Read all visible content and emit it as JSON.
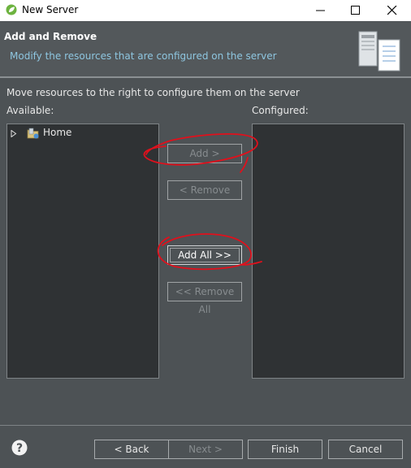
{
  "window": {
    "title": "New Server"
  },
  "header": {
    "title": "Add and Remove",
    "subtitle": "Modify the resources that are configured on the server"
  },
  "main": {
    "description": "Move resources to the right to configure them on the server",
    "available_label": "Available:",
    "configured_label": "Configured:",
    "available_items": [
      {
        "label": "Home",
        "icon": "project-icon",
        "expanded": false
      }
    ],
    "configured_items": []
  },
  "buttons": {
    "add": "Add >",
    "remove": "< Remove",
    "add_all": "Add All >>",
    "remove_all": "<< Remove All"
  },
  "footer": {
    "back": "< Back",
    "next": "Next >",
    "finish": "Finish",
    "cancel": "Cancel"
  },
  "colors": {
    "background": "#4d5255",
    "panel": "#2f3234",
    "subtitle": "#8ec6e0",
    "annotation": "#e0101c"
  }
}
